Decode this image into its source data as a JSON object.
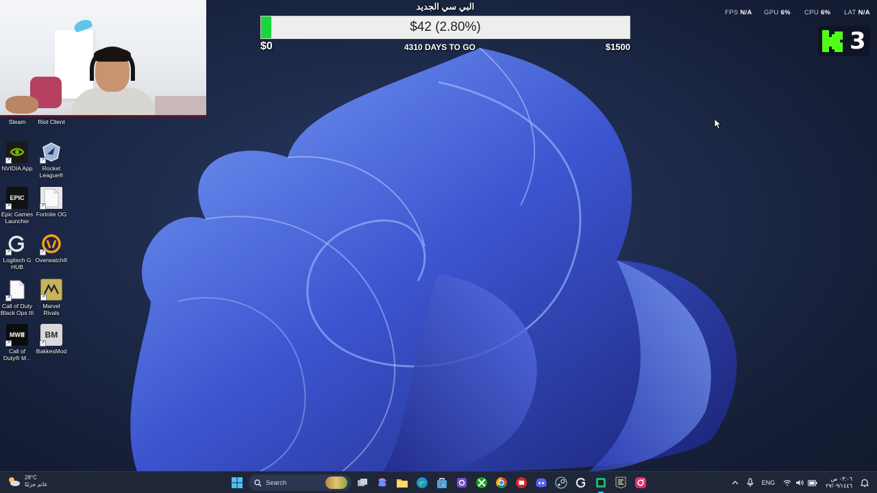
{
  "stream_overlay": {
    "goal_title": "البي سي الجديد",
    "goal_amount": "$42 (2.80%)",
    "goal_progress_fraction": 0.028,
    "goal_min": "$0",
    "goal_days": "4310 DAYS TO GO",
    "goal_max": "$1500",
    "kick_count": "3"
  },
  "perf_overlay": {
    "fps_label": "FPS",
    "fps_value": "N/A",
    "gpu_label": "GPU",
    "gpu_value": "6%",
    "cpu_label": "CPU",
    "cpu_value": "6%",
    "lat_label": "LAT",
    "lat_value": "N/A"
  },
  "desktop_icons": {
    "steam": "Steam",
    "riot": "Riot Client",
    "nvidia": "NVIDIA App",
    "rocket": "Rocket League®",
    "epic": "Epic Games Launcher",
    "fortnite": "Fortnite OG",
    "logitech": "Logitech G HUB",
    "overwatch": "Overwatch®",
    "cod_bo3": "Call of Duty Black Ops III",
    "marvel": "Marvel Rivals",
    "cod_mw": "Call of Duty® M...",
    "bakkes": "BakkesMod",
    "epic_glyph": "EPIC",
    "mw_glyph": "MWⅢ",
    "bakkes_glyph": "BM"
  },
  "taskbar": {
    "weather_temp": "28°C",
    "weather_desc": "غائم جزئيًا",
    "search_placeholder": "Search",
    "lang": "ENG",
    "time": "٠٣:٠٦ ص",
    "date": "٢٧/٠٩/١٤٤٦"
  },
  "colors": {
    "goal_fill": "#19d63f",
    "kick_green": "#53fc18",
    "taskbar_bg": "#1e2638"
  }
}
